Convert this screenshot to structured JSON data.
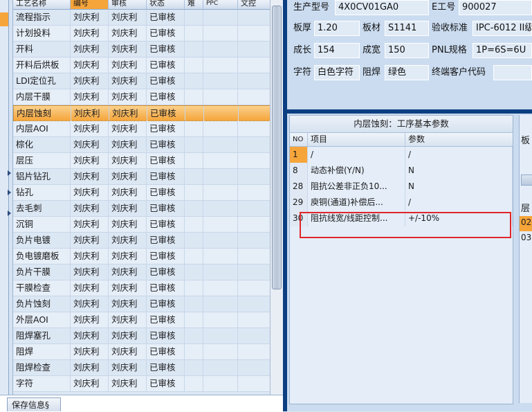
{
  "grid": {
    "columns": [
      "工艺名称",
      "编号",
      "审核",
      "状态",
      "难",
      "PPC",
      "文控"
    ],
    "rows": [
      {
        "name": "流程指示",
        "code": "刘庆利",
        "review": "刘庆利",
        "status": "已审核"
      },
      {
        "name": "计划投料",
        "code": "刘庆利",
        "review": "刘庆利",
        "status": "已审核"
      },
      {
        "name": "开料",
        "code": "刘庆利",
        "review": "刘庆利",
        "status": "已审核"
      },
      {
        "name": "开料后烘板",
        "code": "刘庆利",
        "review": "刘庆利",
        "status": "已审核"
      },
      {
        "name": "LDI定位孔",
        "code": "刘庆利",
        "review": "刘庆利",
        "status": "已审核"
      },
      {
        "name": "内层干膜",
        "code": "刘庆利",
        "review": "刘庆利",
        "status": "已审核"
      },
      {
        "name": "内层蚀刻",
        "code": "刘庆利",
        "review": "刘庆利",
        "status": "已审核"
      },
      {
        "name": "内层AOI",
        "code": "刘庆利",
        "review": "刘庆利",
        "status": "已审核"
      },
      {
        "name": "棕化",
        "code": "刘庆利",
        "review": "刘庆利",
        "status": "已审核"
      },
      {
        "name": "层压",
        "code": "刘庆利",
        "review": "刘庆利",
        "status": "已审核"
      },
      {
        "name": "铝片钻孔",
        "code": "刘庆利",
        "review": "刘庆利",
        "status": "已审核"
      },
      {
        "name": "钻孔",
        "code": "刘庆利",
        "review": "刘庆利",
        "status": "已审核"
      },
      {
        "name": "去毛刺",
        "code": "刘庆利",
        "review": "刘庆利",
        "status": "已审核"
      },
      {
        "name": "沉铜",
        "code": "刘庆利",
        "review": "刘庆利",
        "status": "已审核"
      },
      {
        "name": "负片电镀",
        "code": "刘庆利",
        "review": "刘庆利",
        "status": "已审核"
      },
      {
        "name": "负电镀磨板",
        "code": "刘庆利",
        "review": "刘庆利",
        "status": "已审核"
      },
      {
        "name": "负片干膜",
        "code": "刘庆利",
        "review": "刘庆利",
        "status": "已审核"
      },
      {
        "name": "干膜检查",
        "code": "刘庆利",
        "review": "刘庆利",
        "status": "已审核"
      },
      {
        "name": "负片蚀刻",
        "code": "刘庆利",
        "review": "刘庆利",
        "status": "已审核"
      },
      {
        "name": "外层AOI",
        "code": "刘庆利",
        "review": "刘庆利",
        "status": "已审核"
      },
      {
        "name": "阻焊塞孔",
        "code": "刘庆利",
        "review": "刘庆利",
        "status": "已审核"
      },
      {
        "name": "阻焊",
        "code": "刘庆利",
        "review": "刘庆利",
        "status": "已审核"
      },
      {
        "name": "阻焊检查",
        "code": "刘庆利",
        "review": "刘庆利",
        "status": "已审核"
      },
      {
        "name": "字符",
        "code": "刘庆利",
        "review": "刘庆利",
        "status": "已审核"
      }
    ],
    "selected_index": 6
  },
  "bottom": {
    "save_tab": "保存信息§"
  },
  "form": {
    "model_label": "生产型号",
    "model_value": "4X0CV01GA0",
    "eno_label": "E工号",
    "eno_value": "900027",
    "thickness_label": "板厚",
    "thickness_value": "1.20",
    "material_label": "板材",
    "material_value": "S1141",
    "standard_label": "验收标准",
    "standard_value": "IPC-6012 II级",
    "length_label": "成长",
    "length_value": "154",
    "width_label": "成宽",
    "width_value": "150",
    "pnl_label": "PNL规格",
    "pnl_value": "1P=6S=6U",
    "char_label": "字符",
    "char_value": "白色字符",
    "mask_label": "阻焊",
    "mask_value": "绿色",
    "customer_label": "终端客户代码",
    "customer_value": ""
  },
  "params": {
    "title": "内层蚀刻：工序基本参数",
    "headers": [
      "NO",
      "项目",
      "参数"
    ],
    "rows": [
      {
        "no": "1",
        "item": "/",
        "value": "/"
      },
      {
        "no": "8",
        "item": "动态补偿(Y/N)",
        "value": "N"
      },
      {
        "no": "28",
        "item": "阻抗公差非正负10...",
        "value": "N"
      },
      {
        "no": "29",
        "item": "庾铜(通道)补偿后...",
        "value": "/"
      },
      {
        "no": "30",
        "item": "阻抗线宽/线距控制...",
        "value": "+/-10%"
      }
    ]
  },
  "side": {
    "top_label": "板",
    "layer_label": "层",
    "row1": "02",
    "row2": "03"
  }
}
